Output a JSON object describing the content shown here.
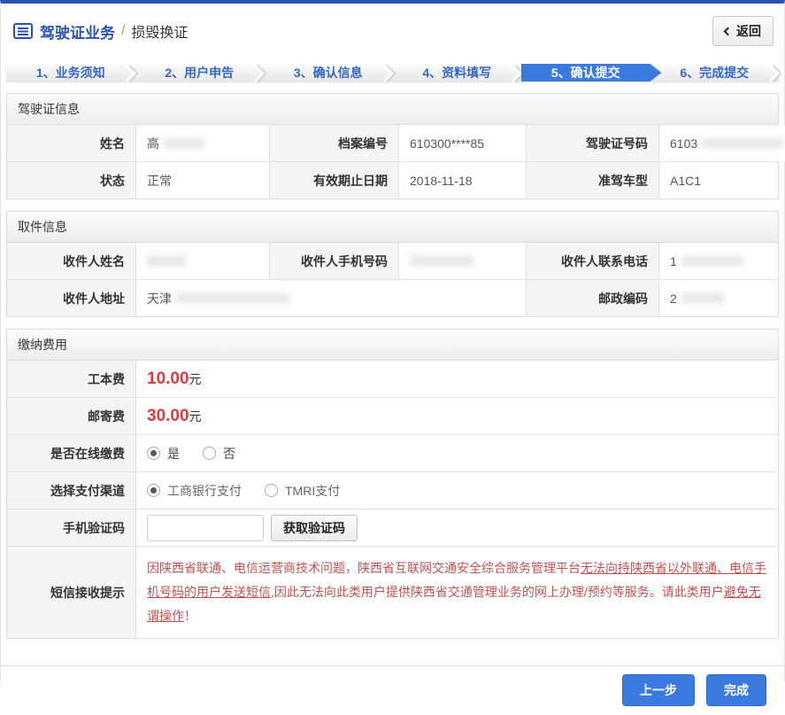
{
  "colors": {
    "accent_blue": "#3b7ade",
    "brand_blue": "#2a52b5",
    "fee_red": "#e4393c",
    "notice_red": "#c15050"
  },
  "header": {
    "title": "驾驶证业务",
    "divider": "/",
    "subtitle": "损毁换证",
    "back_button": "返回"
  },
  "steps": [
    {
      "label": "1、业务须知"
    },
    {
      "label": "2、用户申告"
    },
    {
      "label": "3、确认信息"
    },
    {
      "label": "4、资料填写"
    },
    {
      "label": "5、确认提交",
      "active": true
    },
    {
      "label": "6、完成提交"
    }
  ],
  "license_section": {
    "title": "驾驶证信息",
    "name": {
      "label": "姓名",
      "visible_value": "高",
      "redacted": true
    },
    "file_no": {
      "label": "档案编号",
      "value": "610300****85"
    },
    "license_no": {
      "label": "驾驶证号码",
      "visible_value": "6103",
      "redacted": true
    },
    "status": {
      "label": "状态",
      "value": "正常"
    },
    "expiry": {
      "label": "有效期止日期",
      "value": "2018-11-18"
    },
    "vehicle_class": {
      "label": "准驾车型",
      "value": "A1C1"
    }
  },
  "pickup_section": {
    "title": "取件信息",
    "recipient_name": {
      "label": "收件人姓名",
      "visible_value": "",
      "redacted": true
    },
    "recipient_mobile": {
      "label": "收件人手机号码",
      "visible_value": "",
      "redacted": true
    },
    "recipient_phone": {
      "label": "收件人联系电话",
      "visible_value": "1",
      "redacted": true
    },
    "recipient_address": {
      "label": "收件人地址",
      "visible_value": "天津",
      "redacted": true
    },
    "postal_code": {
      "label": "邮政编码",
      "visible_value": "2",
      "redacted": true
    }
  },
  "payment_section": {
    "title": "缴纳费用",
    "production_fee": {
      "label": "工本费",
      "amount": "10.00",
      "unit": "元"
    },
    "postage_fee": {
      "label": "邮寄费",
      "amount": "30.00",
      "unit": "元"
    },
    "online_payment": {
      "label": "是否在线缴费",
      "options": [
        {
          "label": "是",
          "selected": true
        },
        {
          "label": "否",
          "selected": false
        }
      ]
    },
    "payment_channel": {
      "label": "选择支付渠道",
      "options": [
        {
          "label": "工商银行支付",
          "selected": true
        },
        {
          "label": "TMRI支付",
          "selected": false
        }
      ]
    },
    "sms_code": {
      "label": "手机验证码",
      "input_value": "",
      "button_label": "获取验证码"
    },
    "sms_notice": {
      "label": "短信接收提示",
      "part1": "因陕西省联通、电信运营商技术问题，陕西省互联网交通安全综合服务管理平台",
      "underline1": "无法向持陕西省以外联通、电信手机号码的用户发送短信",
      "part2": ",因此无法向此类用户提供陕西省交通管理业务的网上办理/预约等服务。请此类用户",
      "underline2": "避免无谓操作",
      "part3": "！"
    }
  },
  "footer": {
    "prev_button": "上一步",
    "finish_button": "完成"
  }
}
